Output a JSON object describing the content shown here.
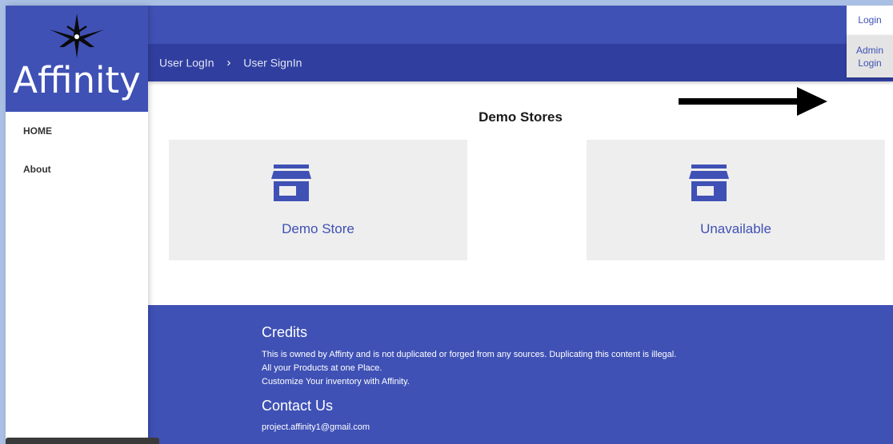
{
  "brand": {
    "name": "Affinity"
  },
  "sidebar": {
    "items": [
      {
        "label": "HOME"
      },
      {
        "label": "About"
      }
    ]
  },
  "breadcrumb": {
    "items": [
      {
        "label": "User LogIn"
      },
      {
        "label": "User SignIn"
      }
    ],
    "separator": "›"
  },
  "account_menu": {
    "login_label": "Login",
    "admin_label_line1": "Admin",
    "admin_label_line2": "Login"
  },
  "main": {
    "section_title": "Demo Stores",
    "cards": [
      {
        "label": "Demo Store",
        "icon": "store-icon"
      },
      {
        "label": "Unavailable",
        "icon": "store-icon"
      }
    ]
  },
  "footer": {
    "credits_title": "Credits",
    "credits_lines": [
      "This is owned by Affinty and is not duplicated or forged from any sources. Duplicating this content is illegal.",
      "All your Products at one Place.",
      "Customize Your inventory with Affinity."
    ],
    "contact_title": "Contact Us",
    "contact_email": "project.affinity1@gmail.com"
  },
  "colors": {
    "primary": "#3f51b5",
    "primary_dark": "#303f9f",
    "card_bg": "#eeeeee",
    "menu_bg": "#e4e4e4"
  }
}
